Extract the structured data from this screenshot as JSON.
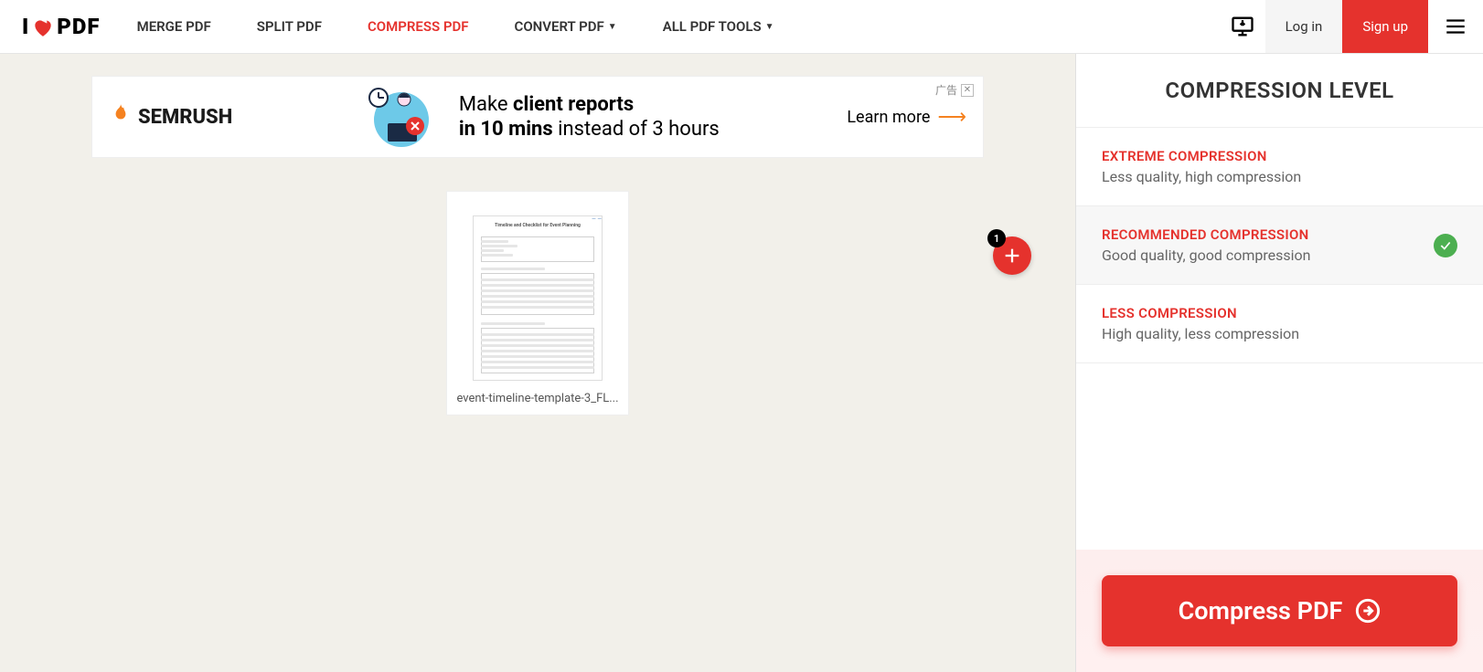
{
  "logo": {
    "left": "I",
    "right": "PDF"
  },
  "nav": {
    "merge": "MERGE PDF",
    "split": "SPLIT PDF",
    "compress": "COMPRESS PDF",
    "convert": "CONVERT PDF",
    "alltools": "ALL PDF TOOLS"
  },
  "header": {
    "login": "Log in",
    "signup": "Sign up"
  },
  "ad": {
    "brand": "SEMRUSH",
    "line1a": "Make ",
    "line1b": "client reports",
    "line2a": "in 10 mins",
    "line2b": " instead of 3 hours",
    "cta": "Learn more",
    "badge": "广告"
  },
  "file": {
    "name": "event-timeline-template-3_FL..."
  },
  "add_badge": "1",
  "sidebar": {
    "title": "COMPRESSION LEVEL",
    "options": [
      {
        "label": "EXTREME COMPRESSION",
        "desc": "Less quality, high compression",
        "selected": false
      },
      {
        "label": "RECOMMENDED COMPRESSION",
        "desc": "Good quality, good compression",
        "selected": true
      },
      {
        "label": "LESS COMPRESSION",
        "desc": "High quality, less compression",
        "selected": false
      }
    ],
    "action": "Compress PDF"
  }
}
